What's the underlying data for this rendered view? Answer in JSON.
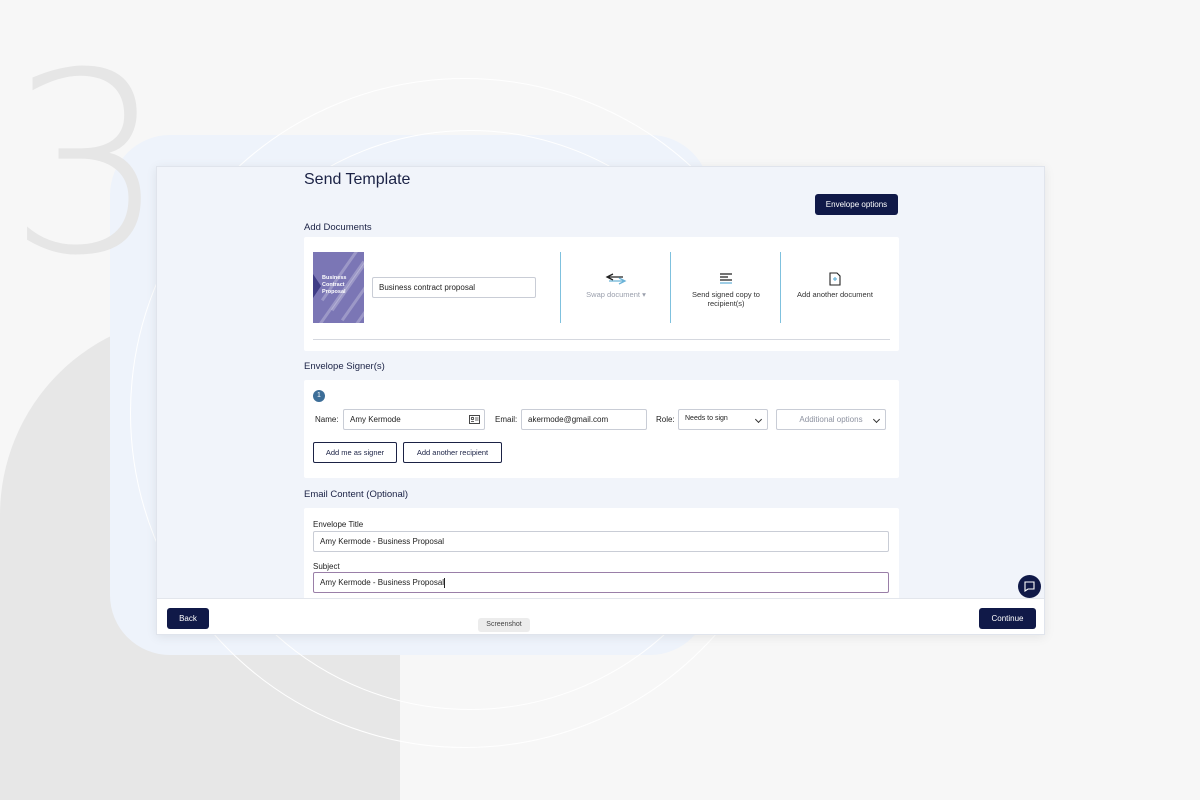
{
  "background": {
    "step_number": "3"
  },
  "header": {
    "title": "Send Template",
    "envelope_options": "Envelope options"
  },
  "documents": {
    "section_label": "Add Documents",
    "thumbnail_title": "Business Contract Proposal",
    "document_name": "Business contract proposal",
    "actions": {
      "swap": "Swap document",
      "send_copy": "Send signed copy to recipient(s)",
      "add_another": "Add another document"
    }
  },
  "signers": {
    "section_label": "Envelope Signer(s)",
    "index": "1",
    "name_label": "Name:",
    "name_value": "Amy Kermode",
    "email_label": "Email:",
    "email_value": "akermode@gmail.com",
    "role_label": "Role:",
    "role_value": "Needs to sign",
    "additional_options": "Additional options",
    "add_me": "Add me as signer",
    "add_recipient": "Add another recipient"
  },
  "email": {
    "section_label": "Email Content (Optional)",
    "title_label": "Envelope Title",
    "title_value": "Amy Kermode - Business Proposal",
    "subject_label": "Subject",
    "subject_value": "Amy Kermode - Business Proposal"
  },
  "footer": {
    "back": "Back",
    "continue": "Continue",
    "screenshot_tag": "Screenshot"
  },
  "colors": {
    "primary": "#101948",
    "accent_divider": "#7fc1de",
    "thumbnail": "#7b76b5",
    "badge": "#3d6e98"
  }
}
